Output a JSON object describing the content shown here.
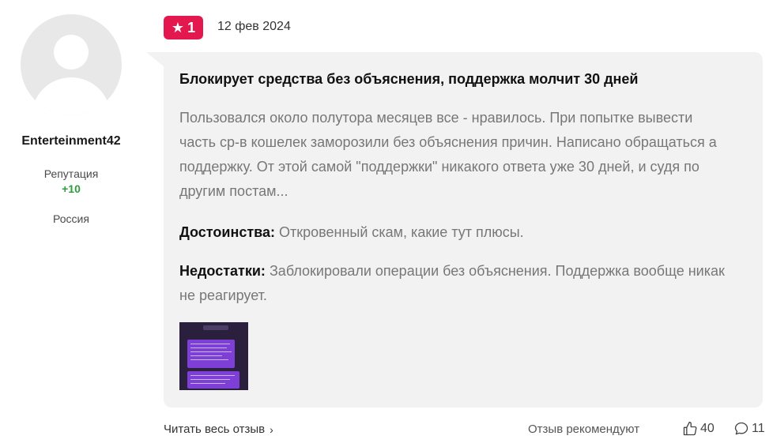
{
  "author": {
    "username": "Enterteinment42",
    "reputation_label": "Репутация",
    "reputation_value": "+10",
    "country": "Россия"
  },
  "review": {
    "rating": "1",
    "date": "12 фев 2024",
    "title": "Блокирует средства без объяснения, поддержка молчит 30 дней",
    "text": "Пользовался около полутора месяцев все - нравилось. При попытке вывести часть ср-в кошелек заморозили без объяснения причин. Написано обращаться а поддержку. От этой самой \"поддержки\" никакого ответа уже 30 дней, и судя по другим постам...",
    "pros_label": "Достоинства:",
    "pros_text": "Откровенный скам, какие тут плюсы.",
    "cons_label": "Недостатки:",
    "cons_text": "Заблокировали операции без объяснения. Поддержка вообще никак не реагирует."
  },
  "footer": {
    "read_more": "Читать весь отзыв",
    "recommend_label": "Отзыв рекомендуют",
    "likes": "40",
    "comments": "11"
  },
  "colors": {
    "rating_badge": "#e3184f",
    "reputation_positive": "#2e9e3a",
    "bubble_bg": "#f2f2f2"
  },
  "icons": {
    "rating": "star-icon",
    "read_more": "chevron-right-icon",
    "likes": "thumbs-up-icon",
    "comments": "comment-icon"
  }
}
